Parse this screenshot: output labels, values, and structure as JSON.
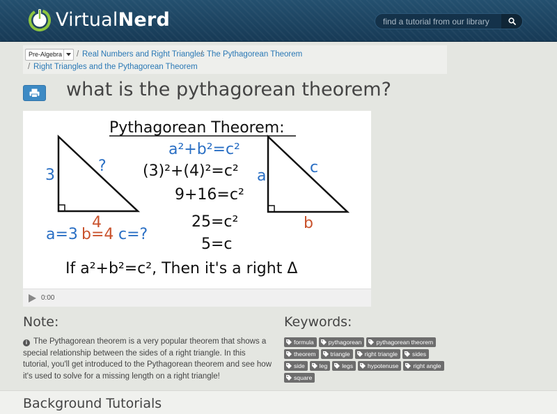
{
  "header": {
    "logo_text_1": "Virtual",
    "logo_text_2": "Nerd",
    "search_placeholder": "find a tutorial from our library",
    "brand_color": "#1b4363",
    "logo_green": "#8dc63f"
  },
  "breadcrumb": {
    "subject": "Pre-Algebra",
    "items": [
      "Real Numbers and Right Triangles",
      "The Pythagorean Theorem",
      "Right Triangles and the Pythagorean Theorem"
    ],
    "separator": "/"
  },
  "page": {
    "title": "what is the pythagorean theorem?"
  },
  "video": {
    "heading": "Pythagorean Theorem:",
    "left_triangle": {
      "side_a": "3",
      "hypotenuse": "?",
      "side_b": "4"
    },
    "right_triangle": {
      "side_a": "a",
      "hypotenuse": "c",
      "side_b": "b"
    },
    "eq1": "a²+b²=c²",
    "eq2": "(3)²+(4)²=c²",
    "eq3": "9+16=c²",
    "eq4": "25=c²",
    "eq5": "5=c",
    "given_a": "a=3",
    "given_b": "b=4",
    "given_c": "c=?",
    "bottom_line": "If a²+b²=c², Then it's a right Δ",
    "time": "0:00"
  },
  "note": {
    "heading": "Note:",
    "text": "The Pythagorean theorem is a very popular theorem that shows a special relationship between the sides of a right triangle. In this tutorial, you'll get introduced to the Pythagorean theorem and see how it's used to solve for a missing length on a right triangle!"
  },
  "keywords": {
    "heading": "Keywords:",
    "tags": [
      "formula",
      "pythagorean",
      "pythagorean theorem",
      "theorem",
      "triangle",
      "right triangle",
      "sides",
      "side",
      "leg",
      "legs",
      "hypotenuse",
      "right angle",
      "square"
    ]
  },
  "background": {
    "heading": "Background Tutorials"
  }
}
